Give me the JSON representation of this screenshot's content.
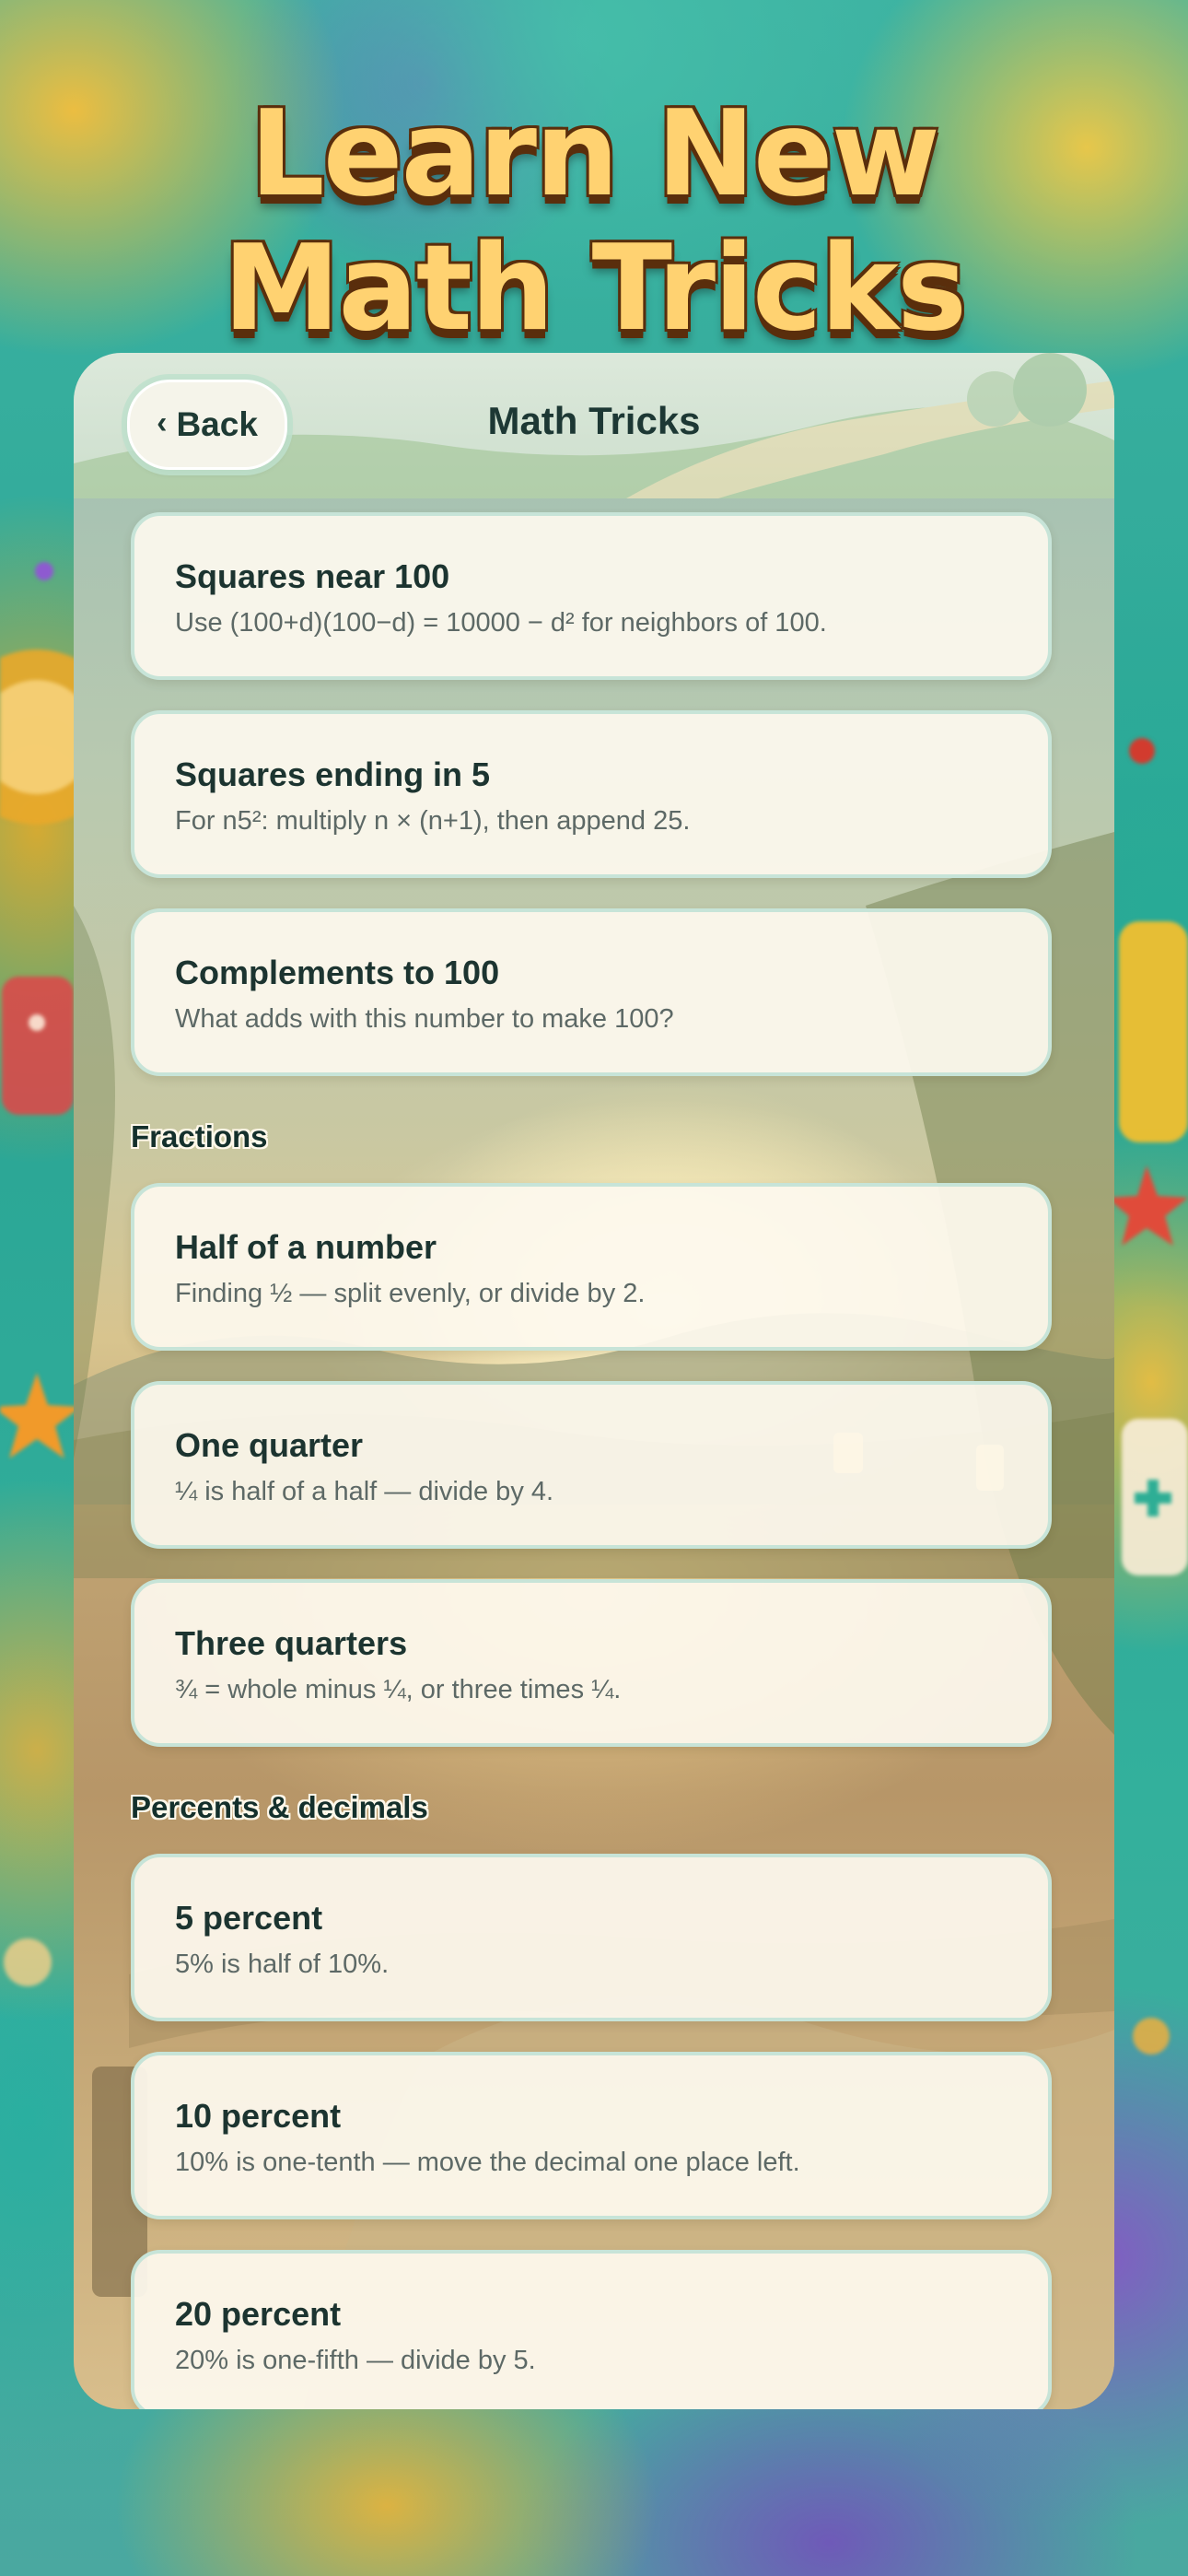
{
  "hero": {
    "line1": "Learn New",
    "line2": "Math Tricks"
  },
  "header": {
    "back_label": "Back",
    "title": "Math Tricks"
  },
  "sections": [
    {
      "label": "",
      "items": [
        {
          "title": "Squares near 100",
          "description": "Use (100+d)(100−d) = 10000 − d² for neighbors of 100."
        },
        {
          "title": "Squares ending in 5",
          "description": "For n5²: multiply n × (n+1), then append 25."
        },
        {
          "title": "Complements to 100",
          "description": "What adds with this number to make 100?"
        }
      ]
    },
    {
      "label": "Fractions",
      "items": [
        {
          "title": "Half of a number",
          "description": "Finding ½ — split evenly, or divide by 2."
        },
        {
          "title": "One quarter",
          "description": "¼ is half of a half — divide by 4."
        },
        {
          "title": "Three quarters",
          "description": "¾ = whole minus ¼, or three times ¼."
        }
      ]
    },
    {
      "label": "Percents & decimals",
      "items": [
        {
          "title": "5 percent",
          "description": "5% is half of 10%."
        },
        {
          "title": "10 percent",
          "description": "10% is one-tenth — move the decimal one place left."
        },
        {
          "title": "20 percent",
          "description": "20% is one-fifth — divide by 5."
        }
      ]
    }
  ],
  "icons": {
    "back": "chevron-left-icon"
  },
  "colors": {
    "title_fill": "#ffd271",
    "title_outline": "#5a2e0c",
    "card_border": "#c7e4d8",
    "card_bg": "#fdf9ee",
    "heading_text": "#1c3430"
  }
}
